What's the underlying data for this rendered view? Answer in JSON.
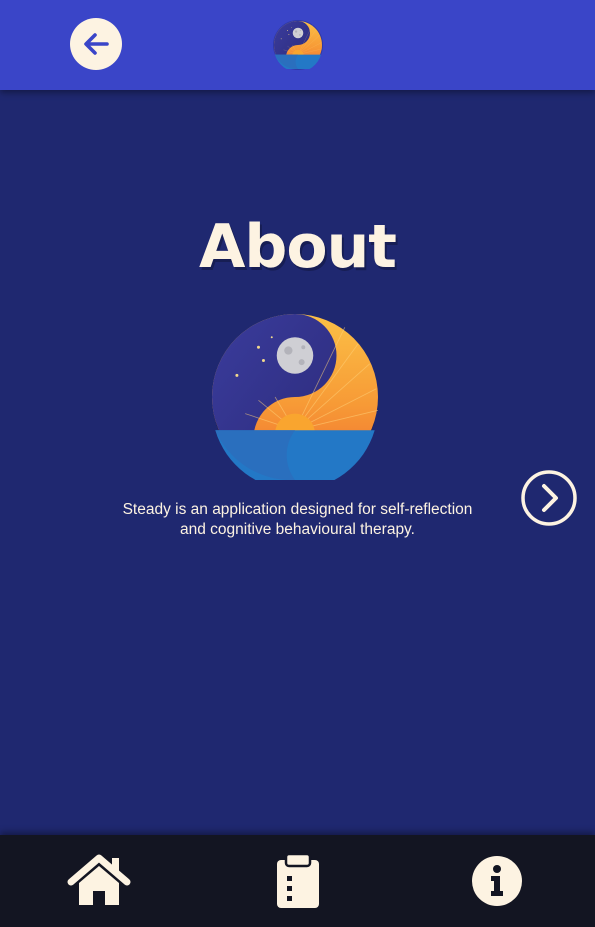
{
  "header": {
    "back_icon": "arrow-left-icon",
    "logo_icon": "yin-yang-sunset-logo-icon"
  },
  "main": {
    "title": "About",
    "logo_icon": "yin-yang-sunset-logo-icon",
    "description": "Steady is an application designed for self-reflection and cognitive behavioural therapy.",
    "next_icon": "chevron-right-circle-icon"
  },
  "nav": {
    "items": [
      {
        "icon": "home-icon"
      },
      {
        "icon": "clipboard-icon"
      },
      {
        "icon": "info-icon"
      }
    ]
  },
  "colors": {
    "topbar": "#3a45c8",
    "background": "#1f2870",
    "bottombar": "#131522",
    "cream": "#fdf3e2",
    "orange": "#f5892f",
    "sea": "#2378c6"
  }
}
